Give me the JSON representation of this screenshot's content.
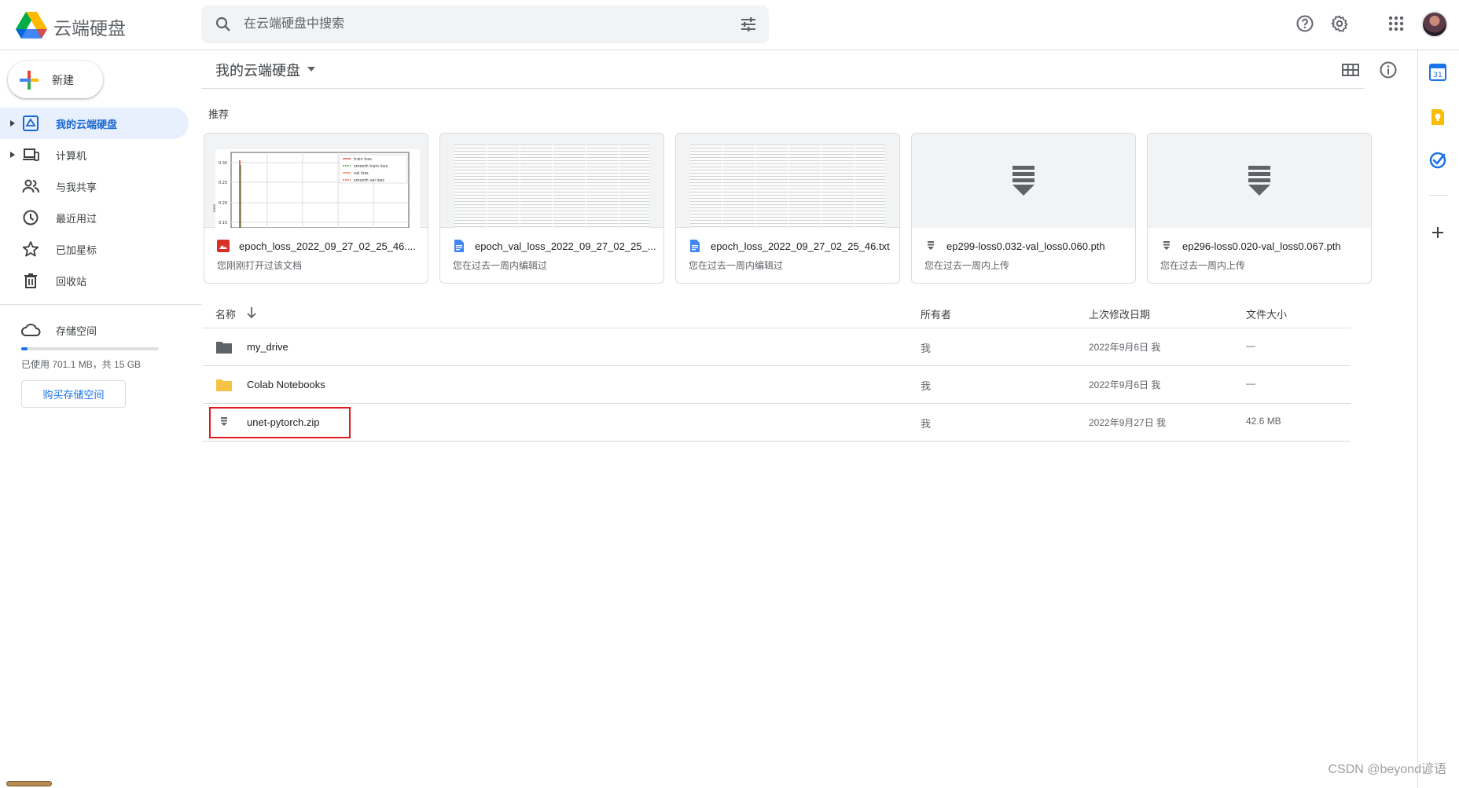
{
  "header": {
    "app_title": "云端硬盘",
    "search_placeholder": "在云端硬盘中搜索"
  },
  "sidebar": {
    "new_label": "新建",
    "items": [
      {
        "label": "我的云端硬盘",
        "icon": "drive-icon",
        "active": true
      },
      {
        "label": "计算机",
        "icon": "computer-icon",
        "active": false
      },
      {
        "label": "与我共享",
        "icon": "shared-icon",
        "active": false
      },
      {
        "label": "最近用过",
        "icon": "recent-icon",
        "active": false
      },
      {
        "label": "已加星标",
        "icon": "star-icon",
        "active": false
      },
      {
        "label": "回收站",
        "icon": "trash-icon",
        "active": false
      }
    ],
    "storage": {
      "label": "存储空间",
      "usage_text": "已使用 701.1 MB，共 15 GB",
      "used_fraction": 0.046,
      "buy_label": "购买存储空间"
    }
  },
  "main": {
    "breadcrumb": "我的云端硬盘",
    "suggested_label": "推荐",
    "cards": [
      {
        "title": "epoch_loss_2022_09_27_02_25_46....",
        "subtitle": "您刚刚打开过该文档",
        "type": "image"
      },
      {
        "title": "epoch_val_loss_2022_09_27_02_25_...",
        "subtitle": "您在过去一周内编辑过",
        "type": "doc"
      },
      {
        "title": "epoch_loss_2022_09_27_02_25_46.txt",
        "subtitle": "您在过去一周内编辑过",
        "type": "doc"
      },
      {
        "title": "ep299-loss0.032-val_loss0.060.pth",
        "subtitle": "您在过去一周内上传",
        "type": "zip"
      },
      {
        "title": "ep296-loss0.020-val_loss0.067.pth",
        "subtitle": "您在过去一周内上传",
        "type": "zip"
      }
    ],
    "chart_thumb": {
      "ticks": [
        "0.30",
        "0.25",
        "0.20",
        "0.15"
      ],
      "axis_label": "Loss",
      "legend": [
        "train loss",
        "smooth train loss",
        "val loss",
        "smooth val loss"
      ]
    },
    "table": {
      "headers": {
        "name": "名称",
        "owner": "所有者",
        "modified": "上次修改日期",
        "size": "文件大小"
      },
      "rows": [
        {
          "name": "my_drive",
          "owner": "我",
          "modified": "2022年9月6日 我",
          "size": "—",
          "icon": "folder-dark-icon"
        },
        {
          "name": "Colab Notebooks",
          "owner": "我",
          "modified": "2022年9月6日 我",
          "size": "—",
          "icon": "folder-yellow-icon"
        },
        {
          "name": "unet-pytorch.zip",
          "owner": "我",
          "modified": "2022年9月27日 我",
          "size": "42.6 MB",
          "icon": "zip-icon"
        }
      ]
    }
  },
  "side_panel": {
    "calendar_day": "31"
  },
  "watermark": "CSDN @beyond谚语"
}
